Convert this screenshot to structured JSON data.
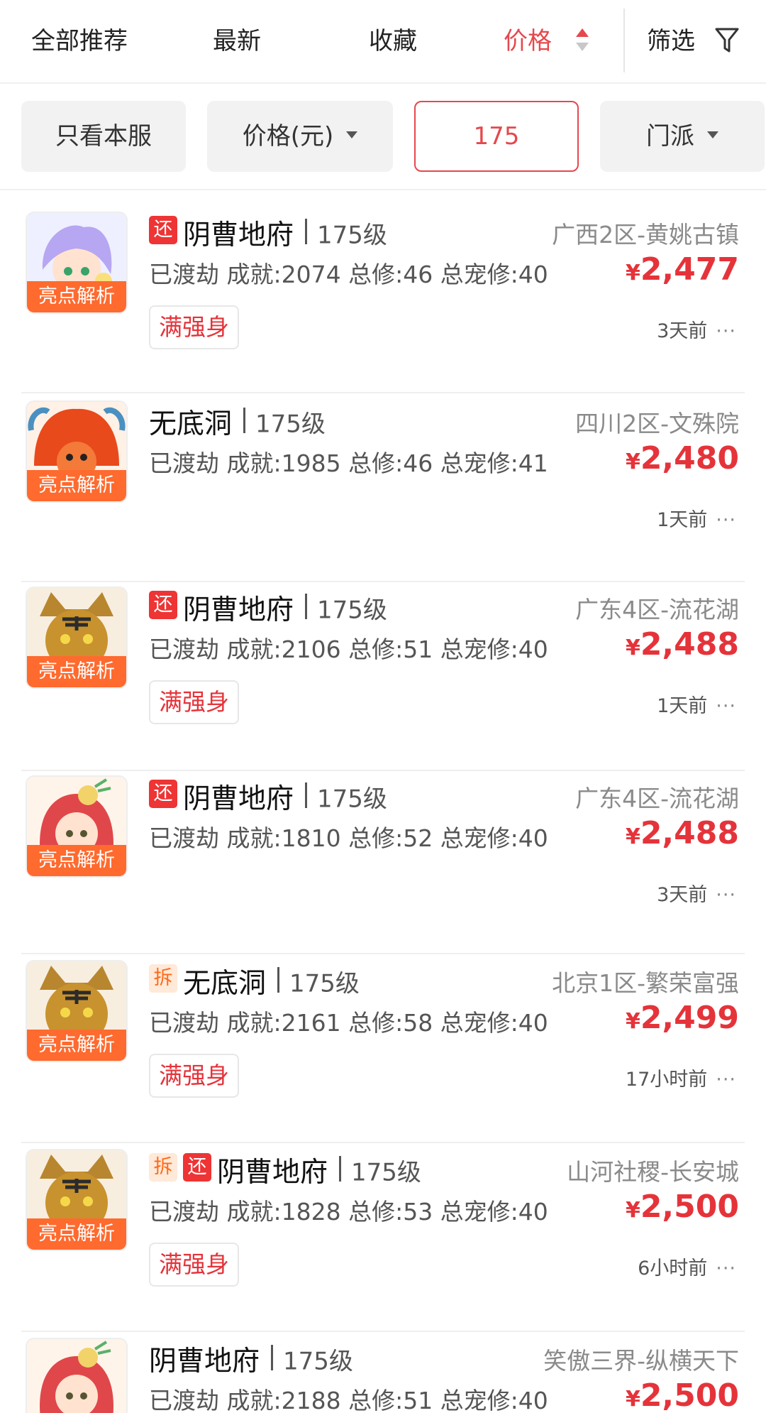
{
  "tabs": {
    "all": "全部推荐",
    "newest": "最新",
    "favorites": "收藏",
    "price": "价格",
    "filter": "筛选"
  },
  "filters": {
    "this_server": "只看本服",
    "price_unit": "价格(元)",
    "level_value": "175",
    "school": "门派"
  },
  "colors": {
    "accent": "#e5484d",
    "price": "#e5333a",
    "badge_return": "#ee3434",
    "badge_split_bg": "#ffe9d8",
    "highlight_ribbon": "#ff6a2e"
  },
  "items": [
    {
      "avatar_icon": "purple-hair-character-avatar",
      "highlight": "亮点解析",
      "badges": [
        "还"
      ],
      "sect": "阴曹地府",
      "level": "175级",
      "server": "广西2区-黄姚古镇",
      "stats": "已渡劫 成就:2074 总修:46 总宠修:40",
      "price_currency": "¥",
      "price": "2,477",
      "tag": "满强身",
      "time": "3天前",
      "more": "···"
    },
    {
      "avatar_icon": "red-mane-monster-avatar",
      "highlight": "亮点解析",
      "badges": [],
      "sect": "无底洞",
      "level": "175级",
      "server": "四川2区-文殊院",
      "stats": "已渡劫 成就:1985 总修:46 总宠修:41",
      "price_currency": "¥",
      "price": "2,480",
      "tag": "",
      "time": "1天前",
      "more": "···"
    },
    {
      "avatar_icon": "tiger-king-avatar",
      "highlight": "亮点解析",
      "badges": [
        "还"
      ],
      "sect": "阴曹地府",
      "level": "175级",
      "server": "广东4区-流花湖",
      "stats": "已渡劫 成就:2106 总修:51 总宠修:40",
      "price_currency": "¥",
      "price": "2,488",
      "tag": "满强身",
      "time": "1天前",
      "more": "···"
    },
    {
      "avatar_icon": "red-hair-girl-avatar",
      "highlight": "亮点解析",
      "badges": [
        "还"
      ],
      "sect": "阴曹地府",
      "level": "175级",
      "server": "广东4区-流花湖",
      "stats": "已渡劫 成就:1810 总修:52 总宠修:40",
      "price_currency": "¥",
      "price": "2,488",
      "tag": "",
      "time": "3天前",
      "more": "···"
    },
    {
      "avatar_icon": "tiger-king-avatar",
      "highlight": "亮点解析",
      "badges": [
        "拆"
      ],
      "sect": "无底洞",
      "level": "175级",
      "server": "北京1区-繁荣富强",
      "stats": "已渡劫 成就:2161 总修:58 总宠修:40",
      "price_currency": "¥",
      "price": "2,499",
      "tag": "满强身",
      "time": "17小时前",
      "more": "···"
    },
    {
      "avatar_icon": "tiger-king-avatar",
      "highlight": "亮点解析",
      "badges": [
        "拆",
        "还"
      ],
      "sect": "阴曹地府",
      "level": "175级",
      "server": "山河社稷-长安城",
      "stats": "已渡劫 成就:1828 总修:53 总宠修:40",
      "price_currency": "¥",
      "price": "2,500",
      "tag": "满强身",
      "time": "6小时前",
      "more": "···"
    },
    {
      "avatar_icon": "red-hair-girl-avatar",
      "highlight": "",
      "badges": [],
      "sect": "阴曹地府",
      "level": "175级",
      "server": "笑傲三界-纵横天下",
      "stats": "已渡劫 成就:2188 总修:51 总宠修:40",
      "price_currency": "¥",
      "price": "2,500",
      "tag": "",
      "time": "",
      "more": ""
    }
  ]
}
